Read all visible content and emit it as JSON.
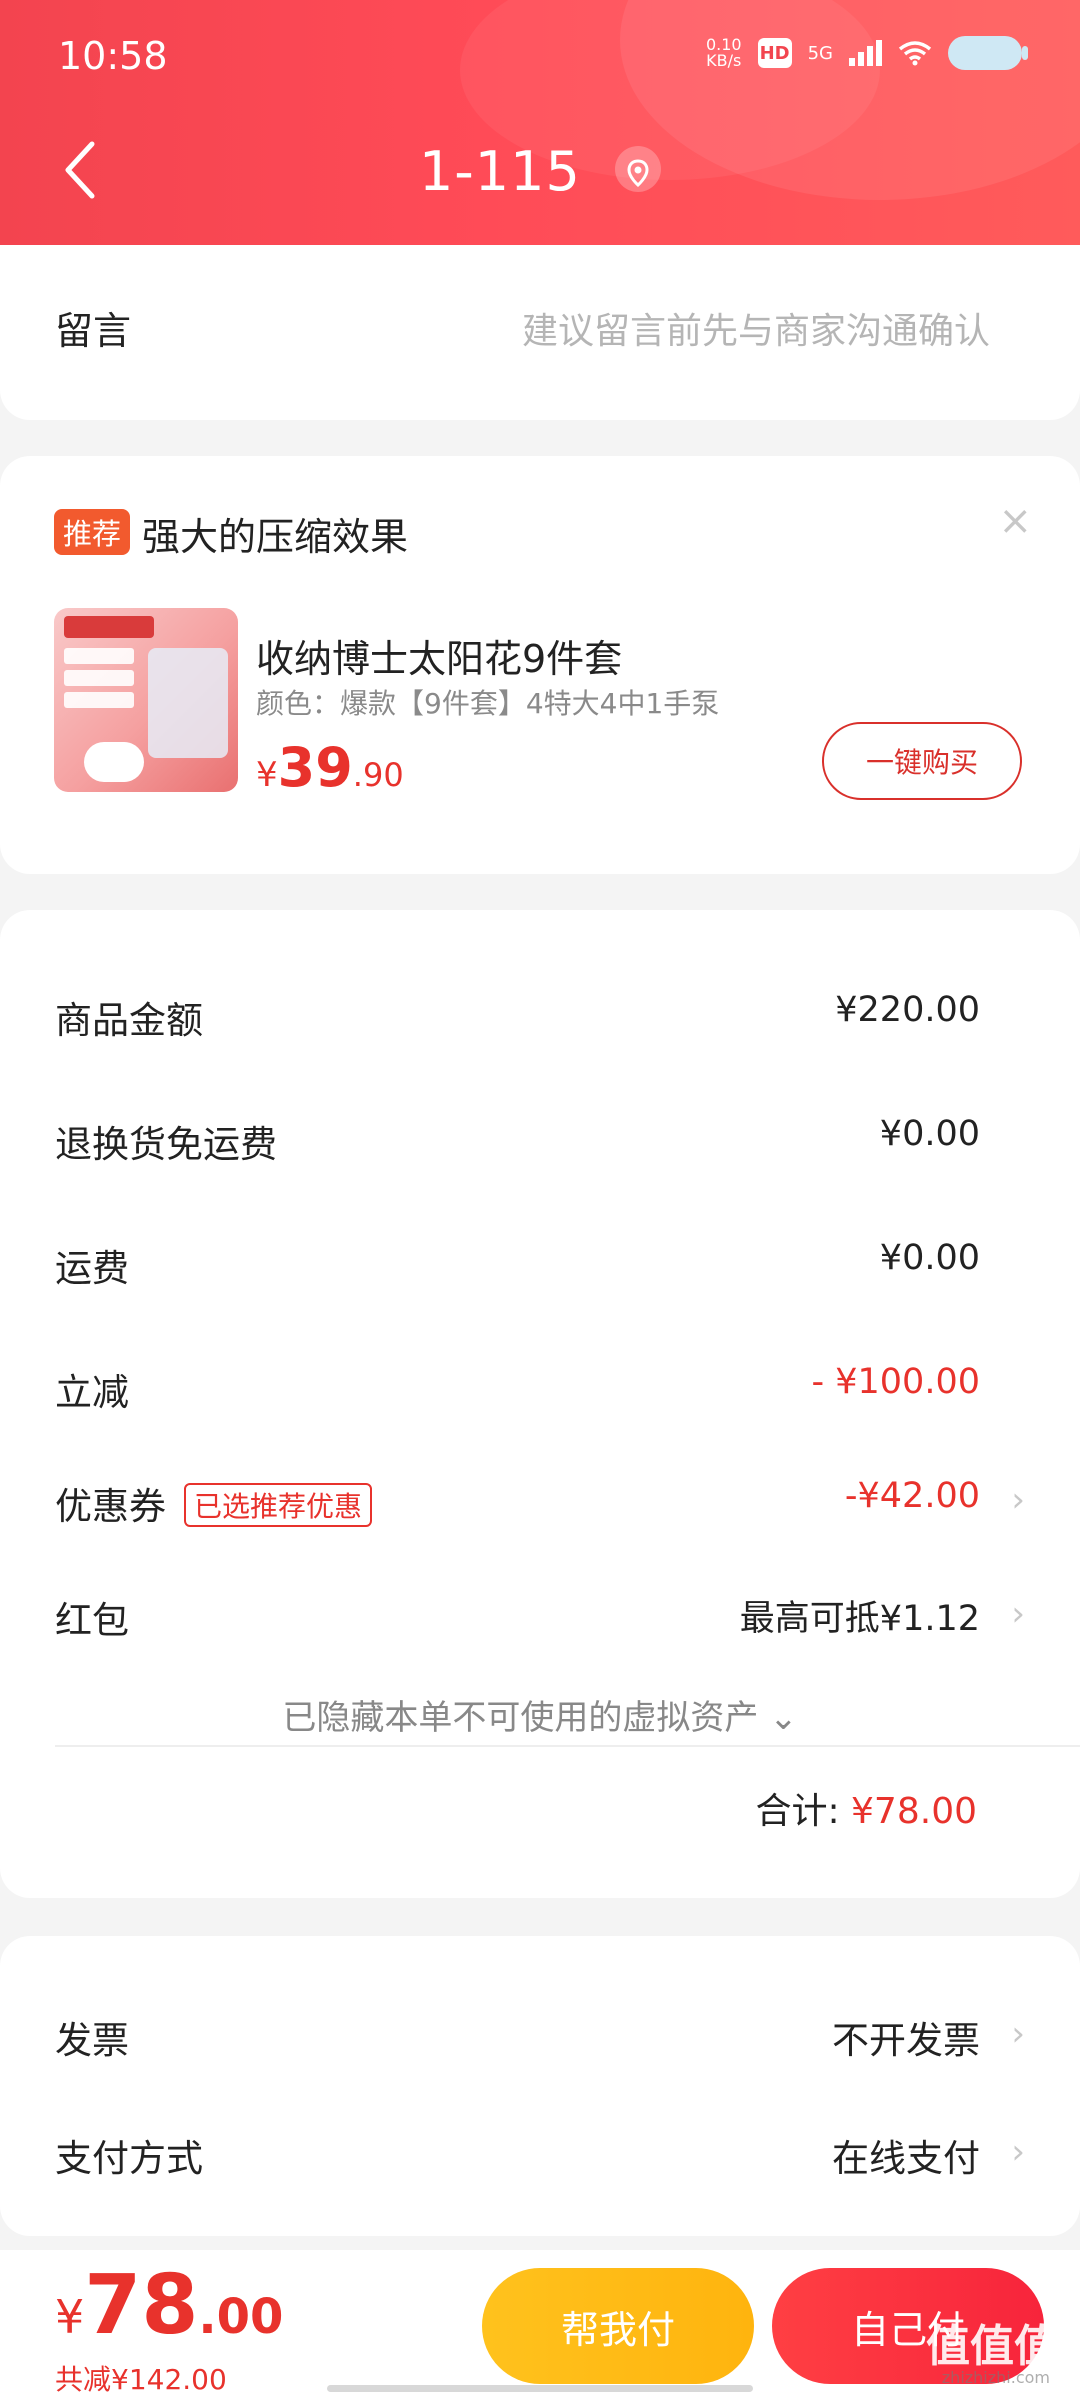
{
  "status": {
    "time": "10:58",
    "net_speed": "0.10\nKB/s",
    "hd": "HD",
    "signal": "5G"
  },
  "nav": {
    "title": "1-115"
  },
  "message": {
    "label": "留言",
    "placeholder": "建议留言前先与商家沟通确认"
  },
  "recommend": {
    "badge": "推荐",
    "title": "强大的压缩效果",
    "close": "×",
    "product": {
      "name": "收纳博士太阳花9件套",
      "spec": "颜色：爆款【9件套】4特大4中1手泵",
      "price_currency": "¥",
      "price_int": "39",
      "price_dec": ".90",
      "buy_label": "一键购买"
    }
  },
  "detail": {
    "rows": [
      {
        "label": "商品金额",
        "value": "¥220.00"
      },
      {
        "label": "退换货免运费",
        "value": "¥0.00"
      },
      {
        "label": "运费",
        "value": "¥0.00"
      },
      {
        "label": "立减",
        "value": "- ¥100.00"
      },
      {
        "label": "优惠券",
        "tag": "已选推荐优惠",
        "value": "-¥42.00"
      },
      {
        "label": "红包",
        "value": "最高可抵¥1.12"
      }
    ],
    "hidden_note": "已隐藏本单不可使用的虚拟资产 ⌄",
    "total_label": "合计:",
    "total_value": "¥78.00"
  },
  "payment": {
    "invoice_label": "发票",
    "invoice_value": "不开发票",
    "method_label": "支付方式",
    "method_value": "在线支付"
  },
  "bottom": {
    "currency": "¥",
    "price_int": "78",
    "price_dec": ".00",
    "saved": "共减¥142.00",
    "help_pay": "帮我付",
    "self_pay": "自己付"
  },
  "watermark": {
    "text": "值值值",
    "site": "zhizhizhi.com"
  },
  "colors": {
    "brand_red": "#f3444f",
    "price_red": "#e8322c",
    "help_yellow": "#ffc21d"
  }
}
